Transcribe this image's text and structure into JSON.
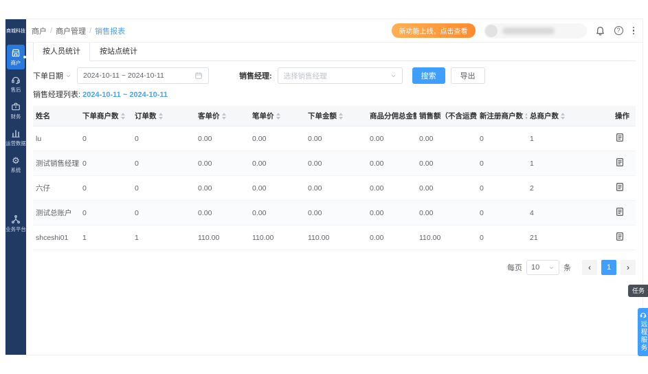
{
  "brand": {
    "logo_text": "商城科技"
  },
  "breadcrumb": {
    "separator": "/",
    "items": [
      "商户",
      "商户管理",
      "销售报表"
    ]
  },
  "topbar": {
    "promo_badge": "新功能上线，点击查看",
    "help_glyph": "?"
  },
  "sidebar": {
    "items": [
      {
        "key": "merchant",
        "label": "商户",
        "icon": "store-icon",
        "active": true
      },
      {
        "key": "aftersale",
        "label": "售后",
        "icon": "headset-icon",
        "active": false
      },
      {
        "key": "finance",
        "label": "财务",
        "icon": "briefcase-icon",
        "active": false
      },
      {
        "key": "operation-data",
        "label": "运营数据",
        "icon": "bar-chart-icon",
        "active": false
      },
      {
        "key": "system",
        "label": "系统",
        "icon": "gear-icon",
        "active": false
      }
    ],
    "bottom": {
      "key": "business-platform",
      "label": "业务平台",
      "icon": "org-icon"
    }
  },
  "tabs": [
    {
      "key": "by-person",
      "label": "按人员统计",
      "active": true
    },
    {
      "key": "by-site",
      "label": "按站点统计",
      "active": false
    }
  ],
  "filters": {
    "date_type_label": "下单日期",
    "date_range": "2024-10-11 ~ 2024-10-11",
    "manager_label": "销售经理:",
    "manager_placeholder": "选择销售经理",
    "search_label": "搜索",
    "export_label": "导出"
  },
  "summary": {
    "label": "销售经理列表:",
    "range": "2024-10-11 ~ 2024-10-11"
  },
  "table": {
    "columns": [
      {
        "label": "姓名",
        "sortable": false
      },
      {
        "label": "下单商户数",
        "sortable": true
      },
      {
        "label": "订单数",
        "sortable": true
      },
      {
        "label": "客单价",
        "sortable": true
      },
      {
        "label": "笔单价",
        "sortable": true
      },
      {
        "label": "下单金额",
        "sortable": true
      },
      {
        "label": "商品分佣总金额",
        "sortable": false
      },
      {
        "label": "销售额（不含运费）",
        "sortable": true,
        "sorted": "desc"
      },
      {
        "label": "新注册商户数",
        "sortable": true
      },
      {
        "label": "总商户数",
        "sortable": true
      },
      {
        "label": "操作",
        "sortable": false
      }
    ],
    "rows": [
      [
        "lu",
        "0",
        "0",
        "0.00",
        "0.00",
        "0.00",
        "0.00",
        "0.00",
        "0",
        "1"
      ],
      [
        "测试销售经理",
        "0",
        "0",
        "0.00",
        "0.00",
        "0.00",
        "0.00",
        "0.00",
        "0",
        "1"
      ],
      [
        "六仔",
        "0",
        "0",
        "0.00",
        "0.00",
        "0.00",
        "0.00",
        "0.00",
        "0",
        "2"
      ],
      [
        "测试总账户",
        "0",
        "0",
        "0.00",
        "0.00",
        "0.00",
        "0.00",
        "0.00",
        "0",
        "4"
      ],
      [
        "shceshi01",
        "1",
        "1",
        "110.00",
        "110.00",
        "110.00",
        "0.00",
        "110.00",
        "0",
        "21"
      ]
    ]
  },
  "pagination": {
    "per_page_label": "每页",
    "per_page_value": "10",
    "unit_label": "条",
    "prev_label": "‹",
    "next_label": "›",
    "pages": [
      "1"
    ],
    "active_page": "1"
  },
  "floating": {
    "task_tag": "任务",
    "service_button": "远程服务"
  },
  "colors": {
    "sidebar_bg": "#213a63",
    "sidebar_active": "#2a79dd",
    "primary": "#409eff",
    "link_blue": "#4da3e6",
    "promo_gradient_from": "#ffb055",
    "promo_gradient_to": "#ff8a2e",
    "table_header_bg": "#f6f7f9"
  }
}
